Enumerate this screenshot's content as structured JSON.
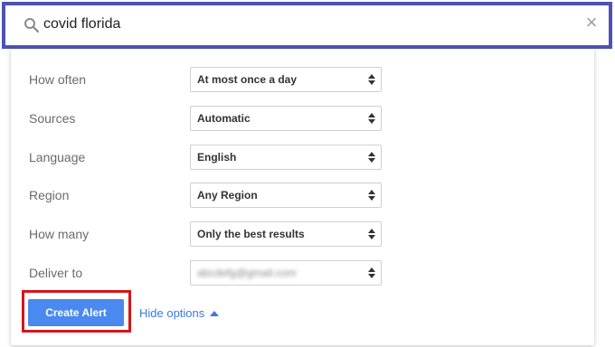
{
  "search": {
    "query": "covid florida",
    "clear_symbol": "×"
  },
  "options": [
    {
      "label": "How often",
      "value": "At most once a day"
    },
    {
      "label": "Sources",
      "value": "Automatic"
    },
    {
      "label": "Language",
      "value": "English"
    },
    {
      "label": "Region",
      "value": "Any Region"
    },
    {
      "label": "How many",
      "value": "Only the best results"
    },
    {
      "label": "Deliver to",
      "value": "abcdefg@gmail.com",
      "blurred": true
    }
  ],
  "actions": {
    "create_label": "Create Alert",
    "hide_options_label": "Hide options"
  },
  "colors": {
    "search_border": "#4c53b4",
    "primary_button": "#4a89ef",
    "highlight_box": "#d4161b",
    "link": "#3b78e7"
  }
}
